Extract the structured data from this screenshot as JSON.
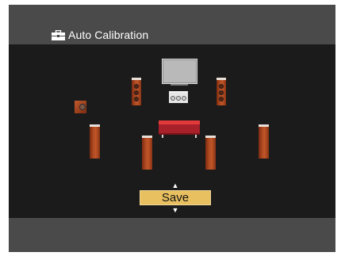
{
  "header": {
    "title": "Auto Calibration",
    "icon": "toolbox-icon"
  },
  "layout_icons": {
    "tv": "tv-icon",
    "center_speaker": "center-speaker-icon",
    "front_left": "front-left-speaker-icon",
    "front_right": "front-right-speaker-icon",
    "subwoofer": "subwoofer-icon",
    "surround_left": "surround-left-speaker-icon",
    "surround_right": "surround-right-speaker-icon",
    "surround_back_left": "surround-back-left-speaker-icon",
    "surround_back_right": "surround-back-right-speaker-icon",
    "listening_position": "couch-icon"
  },
  "action": {
    "save_label": "Save",
    "up_arrow": "▲",
    "down_arrow": "▼"
  },
  "colors": {
    "background": "#1c1c1c",
    "bar": "#4a4a4a",
    "speaker_wood": "#b04a22",
    "couch": "#a8202a",
    "highlight": "#e8c060"
  }
}
